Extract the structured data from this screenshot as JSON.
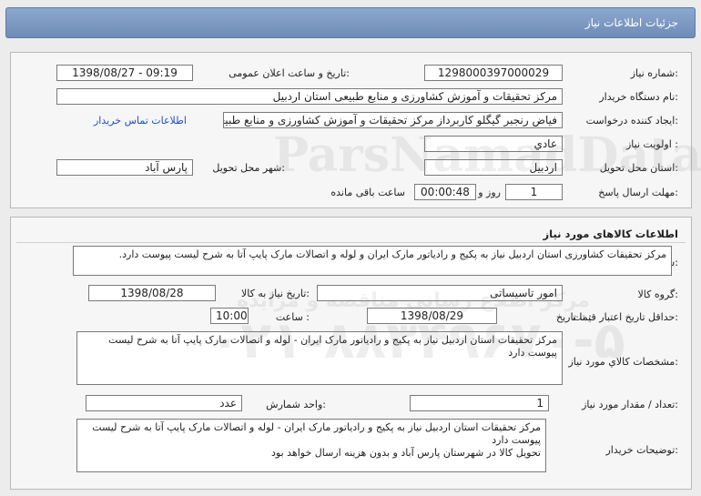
{
  "header": {
    "title": "جزئیات اطلاعات نیاز"
  },
  "need_info": {
    "need_number_label": "شماره نیاز:",
    "need_number": "1298000397000029",
    "announce_label": "تاریخ و ساعت اعلان عمومی:",
    "announce_value": "1398/08/27 - 09:19",
    "buyer_label": "نام دستگاه خریدار:",
    "buyer_value": "مرکز تحقیقات و آموزش کشاورزی و منابع طبیعی استان اردبیل",
    "creator_label": "ایجاد کننده درخواست:",
    "creator_value": "فیاض رنجبر گیگلو کاربرداز مرکز تحقیقات و آموزش کشاورزی و منابع طبیعی استان",
    "contact_link": "اطلاعات تماس خریدار",
    "priority_label": "اولویت نیاز :",
    "priority_value": "عادي",
    "province_label": "استان محل تحویل:",
    "province_value": "اردبیل",
    "city_label": "شهر محل تحویل:",
    "city_value": "پارس آباد",
    "deadline_label": "مهلت ارسال پاسخ:",
    "deadline_days": "1",
    "days_and_label": "روز و",
    "deadline_time": "00:00:48",
    "remaining_label": "ساعت باقی مانده"
  },
  "goods": {
    "section_title": "اطلاعات کالاهای مورد نیاز",
    "general_desc_label": "شرح کلي نیاز:",
    "general_desc": "مرکز تحقیقات کشاورزی استان اردبیل نیاز به پکیج و رادیاتور مارک ایران و لوله و اتصالات مارک پایپ آتا به شرح لیست پیوست دارد.",
    "group_label": "گروه کالا:",
    "group_value": "امور تاسیساتی",
    "need_date_label": "تاریخ نیاز به کالا:",
    "need_date_value": "1398/08/28",
    "min_valid_label": "حداقل تاریخ اعتبار قیمت:",
    "until_date_label": "تا تاریخ :",
    "until_date_value": "1398/08/29",
    "time_label": "ساعت :",
    "time_value": "10:00",
    "specs_label": "مشخصات کالاي مورد نیاز:",
    "specs_value": "مرکز تحقیقات استان اردبیل نیاز به پکیج و رادیاتور مارک ایران - لوله و اتصالات مارک پایپ آتا به شرح لیست پیوست دارد",
    "qty_label": "تعداد / مقدار مورد نیاز:",
    "qty_value": "1",
    "unit_label": "واحد شمارش:",
    "unit_value": "عدد",
    "buyer_notes_label": "توضیحات خریدار:",
    "buyer_notes_line1": "مرکز تحقیقات استان اردبیل نیاز به پکیج و رادیاتور مارک ایران - لوله و اتصالات مارک پایپ آتا به شرح لیست پیوست دارد",
    "buyer_notes_line2": "تحویل کالا در شهرستان پارس آباد و بدون هزینه ارسال خواهد بود"
  },
  "watermark": {
    "line1": "ParsNamadData",
    "line2": "۰۲۱-۸۸۳۴۹۶۷۰-۵",
    "line3": "مرکز اطلاع رسانی مناقصه و مزایده"
  }
}
